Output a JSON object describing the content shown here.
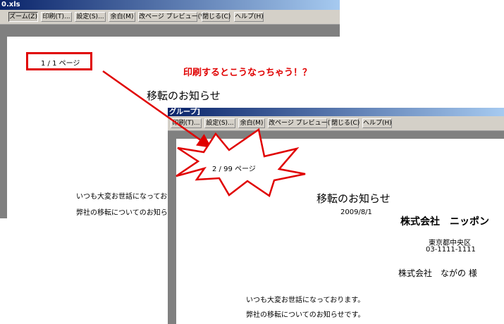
{
  "window1": {
    "title": "0.xls",
    "toolbar": [
      "ズーム(Z)",
      "印刷(T)...",
      "設定(S)...",
      "余白(M)",
      "改ページ プレビュー(V)",
      "閉じる(C)",
      "ヘルプ(H)"
    ],
    "page_indicator": "1 / 1 ページ",
    "doc_title": "移転のお知らせ",
    "body_lines": [
      "いつも大変お世話になっており",
      "弊社の移転についてのお知らせ"
    ]
  },
  "window2": {
    "title": "グループ]",
    "toolbar": [
      "印刷(T)...",
      "設定(S)...",
      "余白(M)",
      "改ページ プレビュー(V)",
      "閉じる(C)",
      "ヘルプ(H)"
    ],
    "page_indicator": "2 / 99 ページ",
    "doc_title": "移転のお知らせ",
    "date": "2009/8/1",
    "company": "株式会社　ニッポン",
    "address": "東京都中央区",
    "phone": "03-1111-1111",
    "recipient": "株式会社　ながの 様",
    "body_lines": [
      "いつも大変お世話になっております。",
      "弊社の移転についてのお知らせです。"
    ]
  },
  "annotation": "印刷するとこうなっちゃう！？",
  "colors": {
    "highlight": "#e00000",
    "toolbar": "#d4d0c8",
    "workspace": "#808080"
  }
}
